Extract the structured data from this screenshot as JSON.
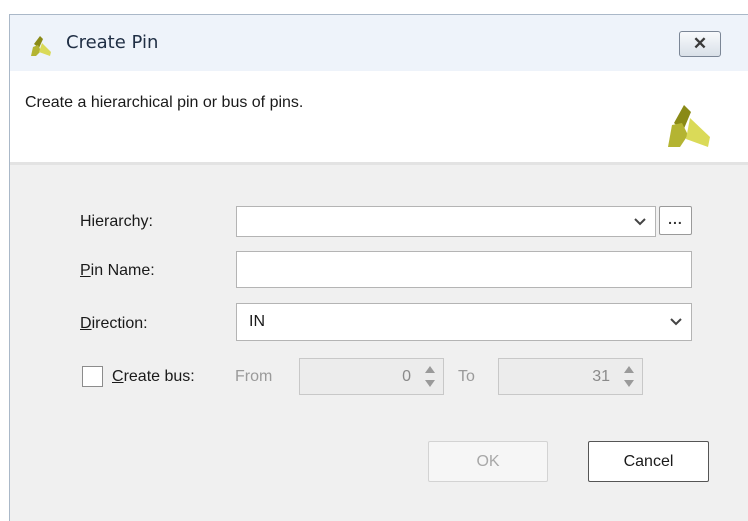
{
  "window": {
    "title": "Create Pin",
    "close_icon": "close-icon"
  },
  "banner": {
    "description": "Create a hierarchical pin or bus of pins."
  },
  "form": {
    "hierarchy_label": "Hierarchy:",
    "hierarchy_value": "",
    "browse_label": "...",
    "pin_name_label_first": "P",
    "pin_name_label_rest": "in Name:",
    "pin_name_value": "",
    "direction_label_first": "D",
    "direction_label_rest": "irection:",
    "direction_value": "IN",
    "create_bus_label_first": "C",
    "create_bus_label_rest": "reate bus:",
    "create_bus_checked": false,
    "from_label": "From",
    "from_value": "0",
    "to_label": "To",
    "to_value": "31"
  },
  "buttons": {
    "ok": "OK",
    "cancel": "Cancel"
  },
  "colors": {
    "logo_dark": "#8a8a16",
    "logo_light": "#dada58",
    "titlebar_bg": "#eef3fa"
  }
}
